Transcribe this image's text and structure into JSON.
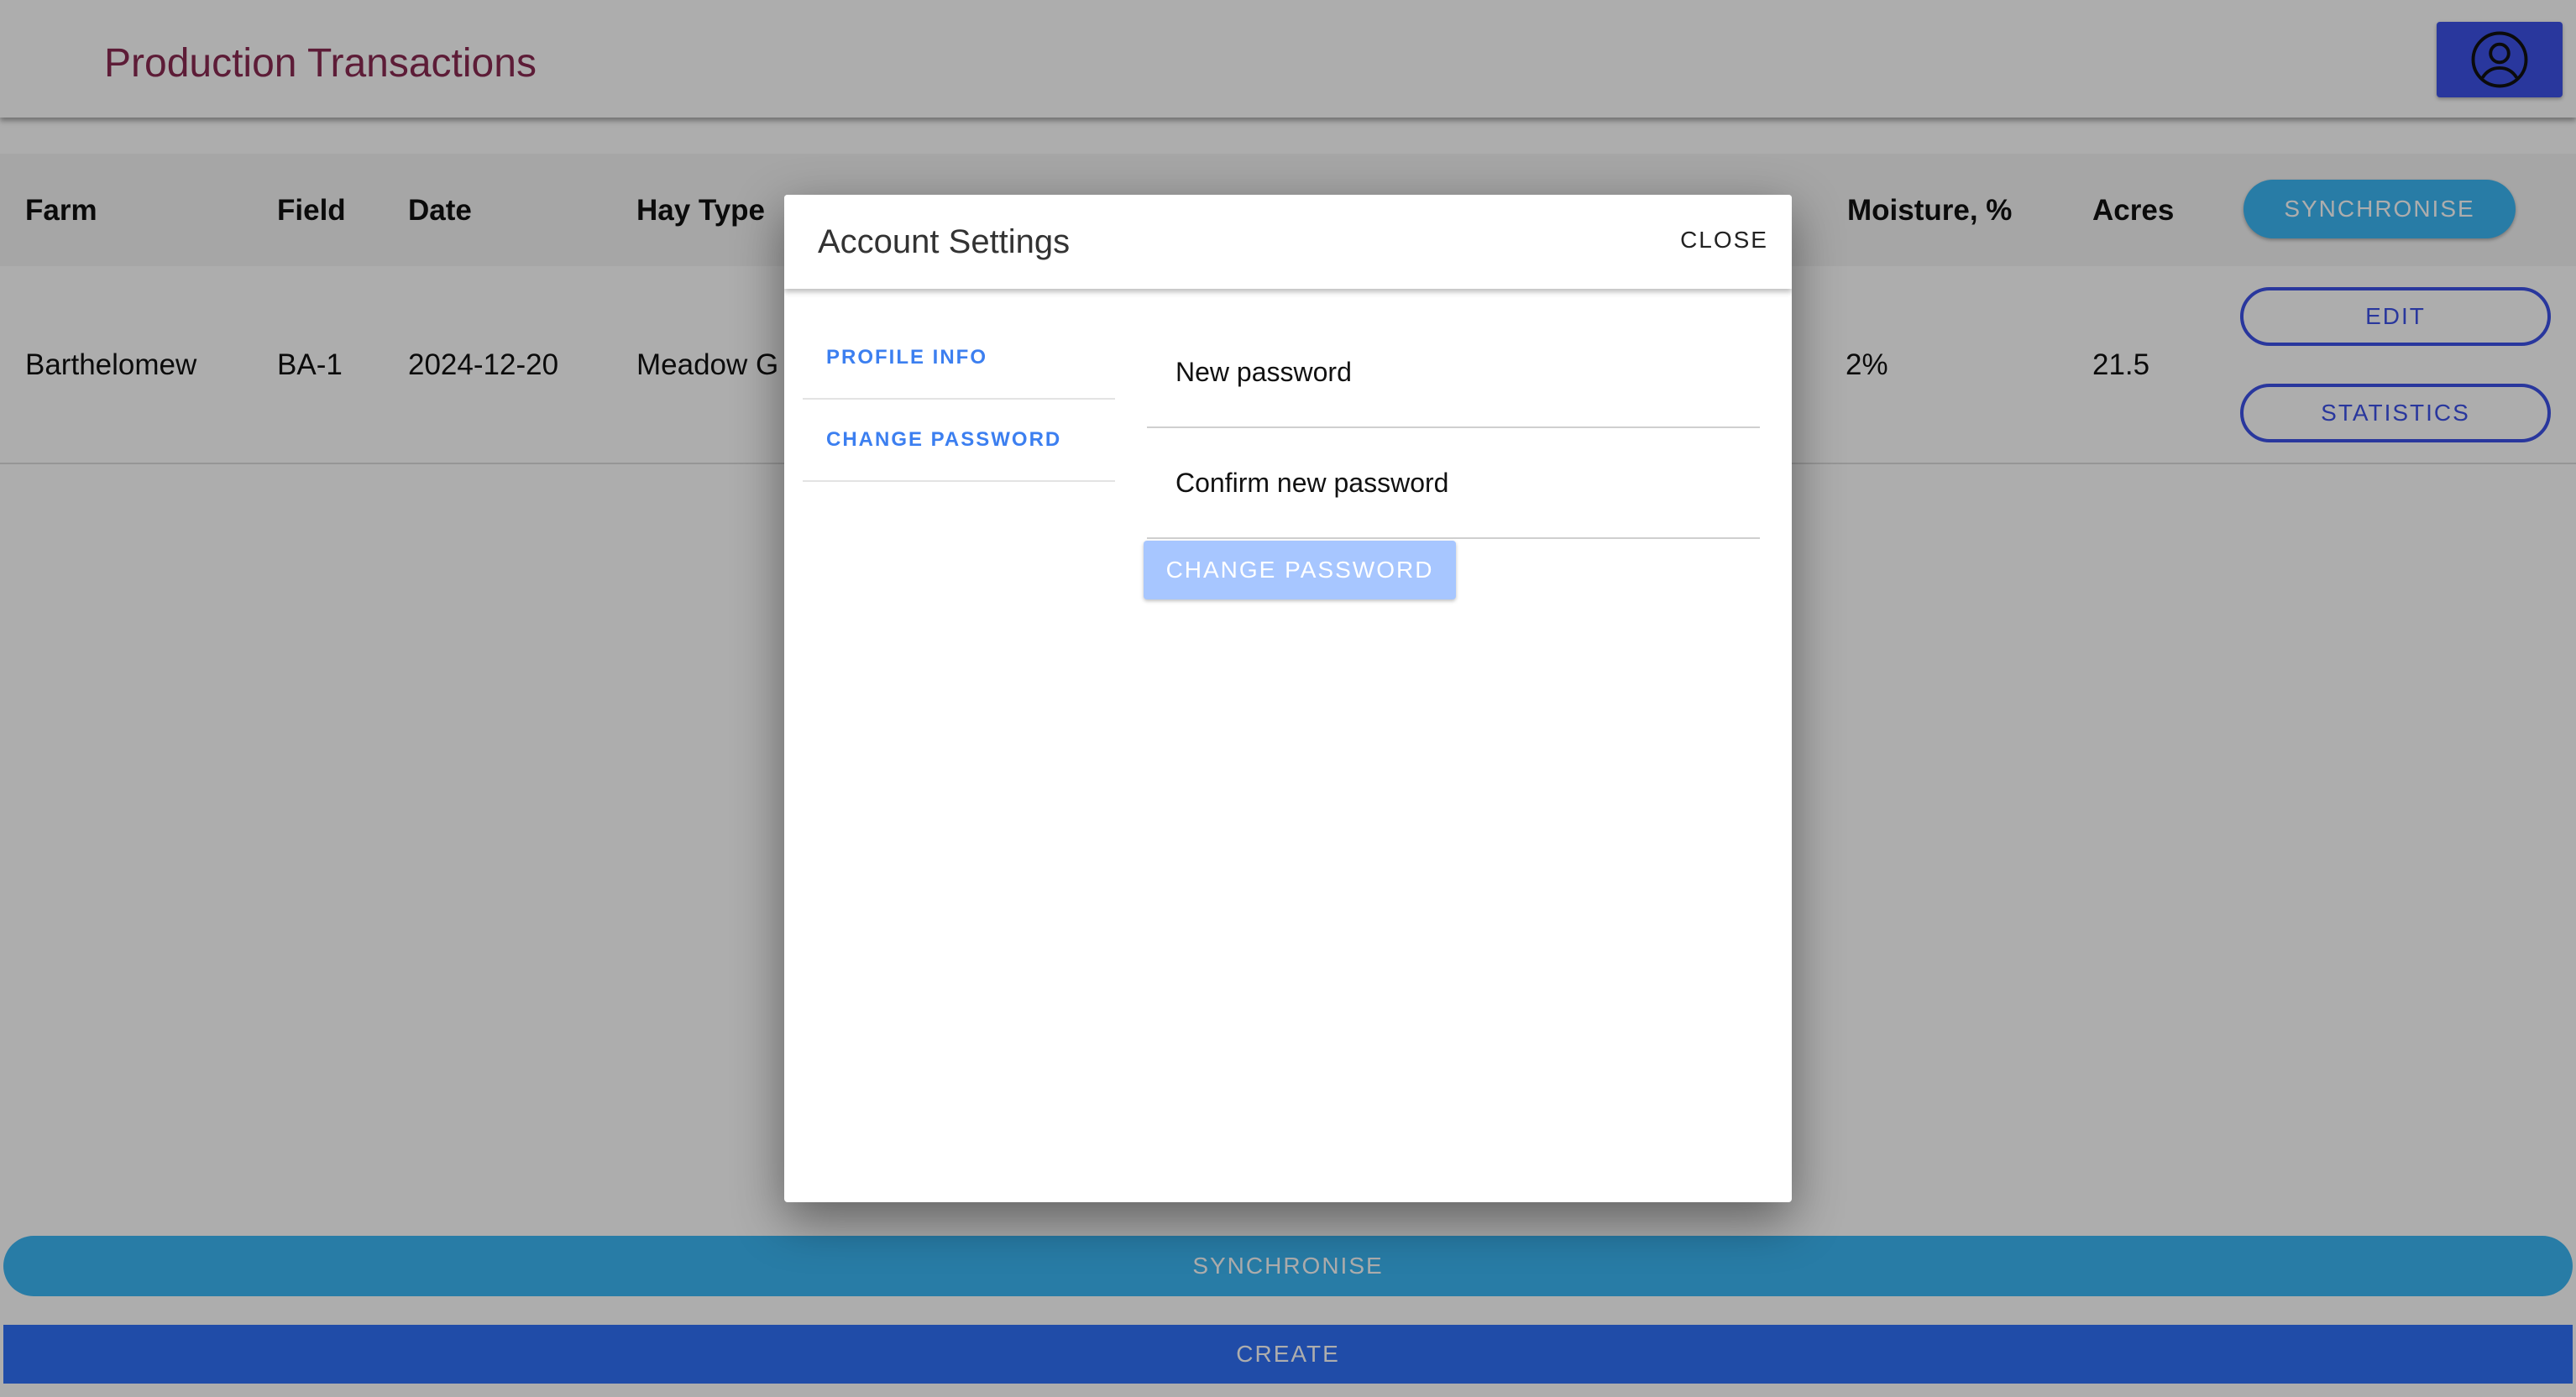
{
  "header": {
    "title": "Production Transactions",
    "account_icon": "user-circle-icon"
  },
  "table": {
    "columns": {
      "farm": "Farm",
      "field": "Field",
      "date": "Date",
      "hay_type": "Hay Type",
      "moisture": "Moisture, %",
      "acres": "Acres"
    },
    "sync_label": "SYNCHRONISE",
    "rows": [
      {
        "farm": "Barthelomew",
        "field": "BA-1",
        "date": "2024-12-20",
        "hay_type": "Meadow G",
        "moisture": "2%",
        "acres": "21.5",
        "edit_label": "EDIT",
        "statistics_label": "STATISTICS"
      }
    ]
  },
  "footer": {
    "sync_label": "SYNCHRONISE",
    "create_label": "CREATE"
  },
  "modal": {
    "title": "Account Settings",
    "close_label": "CLOSE",
    "nav": [
      {
        "label": "PROFILE INFO"
      },
      {
        "label": "CHANGE PASSWORD"
      }
    ],
    "fields": {
      "new_password_placeholder": "New password",
      "confirm_password_placeholder": "Confirm new password"
    },
    "submit_label": "CHANGE PASSWORD"
  },
  "colors": {
    "title": "#8a2a52",
    "primary": "#3d52e8",
    "sync": "#3cb7f5",
    "create": "#3070f8",
    "link": "#3c7ff0",
    "disabled_button": "#a7c6ff"
  }
}
